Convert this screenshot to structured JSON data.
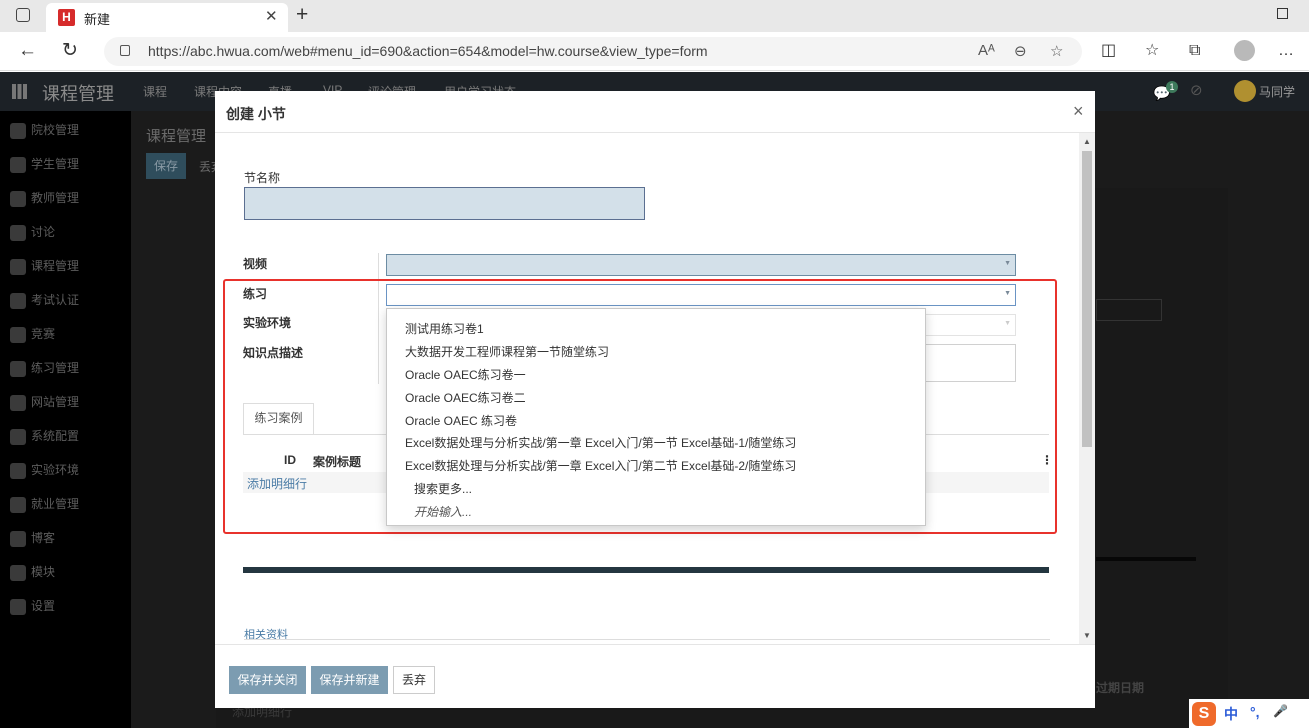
{
  "browser": {
    "tab_title": "新建",
    "tab_favicon": "H",
    "url": "https://abc.hwua.com/web#menu_id=690&action=654&model=hw.course&view_type=form",
    "icons": [
      "back-icon",
      "refresh-icon",
      "lock-icon",
      "read-aloud-icon",
      "zoom-icon",
      "favorite-add-icon",
      "split-screen-icon",
      "favorites-icon",
      "collections-icon",
      "profile-icon",
      "more-icon"
    ]
  },
  "app": {
    "title": "课程管理",
    "menu": [
      "课程",
      "课程内容",
      "直播",
      "VIP",
      "评论管理",
      "用户学习状态"
    ],
    "chat_count": "1",
    "user_name": "马同学",
    "sidebar": [
      "院校管理",
      "学生管理",
      "教师管理",
      "讨论",
      "课程管理",
      "考试认证",
      "竞赛",
      "练习管理",
      "网站管理",
      "系统配置",
      "实验环境",
      "就业管理",
      "博客",
      "模块",
      "设置"
    ],
    "page_title": "课程管理",
    "save_label": "保存",
    "discard_label": "丢弃",
    "bg_date_label": "过期日期",
    "bg_add_line": "添加明细行"
  },
  "modal": {
    "title": "创建 小节",
    "close": "×",
    "section_name_label": "节名称",
    "section_name_value": "",
    "video_label": "视频",
    "exercise_label": "练习",
    "lab_label": "实验环境",
    "knowledge_label": "知识点描述",
    "tab_label": "练习案例",
    "table_headers": [
      "ID",
      "案例标题"
    ],
    "add_line": "添加明细行",
    "related": "相关资料",
    "buttons": {
      "save_close": "保存并关闭",
      "save_new": "保存并新建",
      "discard": "丢弃"
    }
  },
  "dropdown": {
    "options": [
      "测试用练习卷1",
      "大数据开发工程师课程第一节随堂练习",
      "Oracle OAEC练习卷一",
      "Oracle OAEC练习卷二",
      "Oracle OAEC 练习卷",
      "Excel数据处理与分析实战/第一章 Excel入门/第一节 Excel基础-1/随堂练习",
      "Excel数据处理与分析实战/第一章 Excel入门/第二节 Excel基础-2/随堂练习"
    ],
    "search_more": "搜索更多...",
    "start_typing": "开始输入..."
  },
  "ime": {
    "logo": "S",
    "lang": "中",
    "punct": "°,",
    "mic": "🎤"
  },
  "colors": {
    "highlight": "#e8322c",
    "primary_button": "#7c9cb1",
    "required_field": "#d3e0e9",
    "link": "#4b7ca6"
  }
}
